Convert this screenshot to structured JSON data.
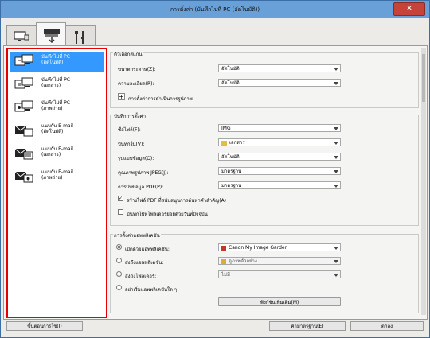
{
  "window": {
    "title": "การตั้งค่า (บันทึกไปที่ PC (อัตโนมัติ))",
    "close_glyph": "✕"
  },
  "tabs": [
    {
      "name": "scan-from-computer-tab",
      "icon": "computer-icon"
    },
    {
      "name": "scan-from-operation-panel-tab",
      "icon": "scanner-icon"
    },
    {
      "name": "general-settings-tab",
      "icon": "tools-icon"
    }
  ],
  "sidebar": {
    "items": [
      {
        "label": "บันทึกไปที่ PC\n(อัตโนมัติ)",
        "icon": "save-to-pc-icon"
      },
      {
        "label": "บันทึกไปที่ PC\n(เอกสาร)",
        "icon": "save-to-pc-icon"
      },
      {
        "label": "บันทึกไปที่ PC\n(ภาพถ่าย)",
        "icon": "save-to-pc-icon"
      },
      {
        "label": "แนบกับ E-mail\n(อัตโนมัติ)",
        "icon": "email-icon"
      },
      {
        "label": "แนบกับ E-mail\n(เอกสาร)",
        "icon": "email-icon"
      },
      {
        "label": "แนบกับ E-mail\n(ภาพถ่าย)",
        "icon": "email-icon"
      }
    ]
  },
  "scan_options": {
    "title": "ตัวเลือกสแกน",
    "paper_size_label": "ขนาดกระดาษ(Z):",
    "paper_size_value": "อัตโนมัติ",
    "resolution_label": "ความละเอียด(R):",
    "resolution_value": "อัตโนมัติ",
    "image_processing_label": "การตั้งค่าการดำเนินการรูปภาพ"
  },
  "save_settings": {
    "title": "บันทึกการตั้งค่า",
    "file_name_label": "ชื่อไฟล์(F):",
    "file_name_value": "IMG",
    "save_in_label": "บันทึกใน(V):",
    "save_in_value": "เอกสาร",
    "data_format_label": "รูปแบบข้อมูล(O):",
    "data_format_value": "อัตโนมัติ",
    "jpeg_quality_label": "คุณภาพรูปภาพ JPEG(J):",
    "jpeg_quality_value": "มาตรฐาน",
    "pdf_compression_label": "การบีบข้อมูล PDF(P):",
    "pdf_compression_value": "มาตรฐาน",
    "create_pdf_keyword_label": "สร้างไฟล์ PDF ที่สนับสนุนการค้นหาคำสำคัญ(A)",
    "create_pdf_keyword_checked": true,
    "save_subfolder_label": "บันทึกไปที่โฟลเดอร์ย่อยด้วยวันที่ปัจจุบัน",
    "save_subfolder_checked": false
  },
  "app_settings": {
    "title": "การตั้งค่าแอพพลิเคชัน",
    "open_app_label": "เปิดด้วยแอพพลิเคชัน:",
    "open_app_value": "Canon My Image Garden",
    "send_app_label": "ส่งถึงแอพพลิเคชัน:",
    "send_app_value": "ดูภาพตัวอย่าง",
    "send_folder_label": "ส่งถึงโฟลเดอร์:",
    "send_folder_value": "ไม่มี",
    "no_app_label": "อย่าเริ่มแอพพลิเคชันใด ๆ",
    "more_functions_label": "ฟังก์ชันเพิ่มเติม(M)",
    "selected": "open"
  },
  "footer": {
    "instructions_label": "ขั้นตอนการใช้(I)",
    "defaults_label": "ค่ามาตรฐาน(E)",
    "ok_label": "ตกลง"
  },
  "colors": {
    "selection": "#3399ff",
    "highlight_border": "#e30000",
    "titlebar": "#69a0d8"
  }
}
